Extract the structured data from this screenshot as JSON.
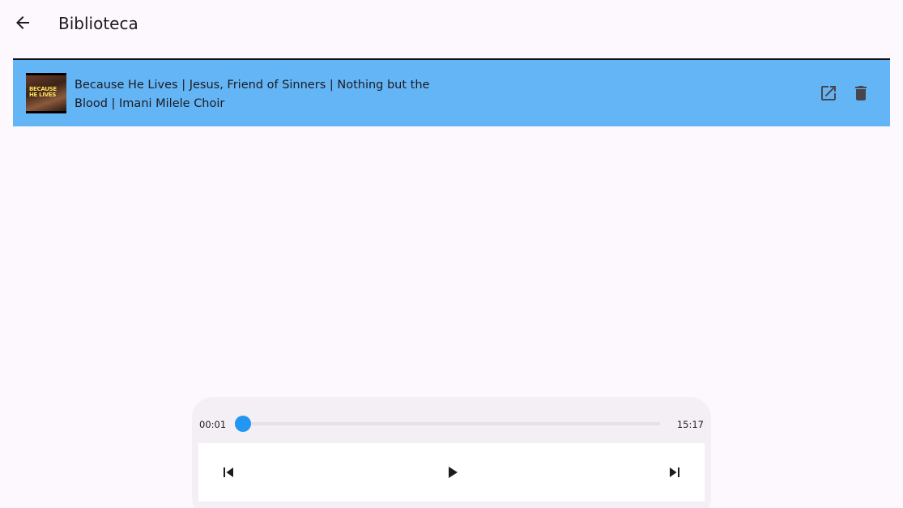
{
  "app_bar": {
    "back_icon": "arrow-back-icon",
    "title": "Biblioteca"
  },
  "library": {
    "items": [
      {
        "title": "Because He Lives | Jesus, Friend of Sinners | Nothing but the Blood | Imani Milele Choir",
        "thumbnail_text": "BECAUSE HE LIVES",
        "open_icon": "open-in-new-icon",
        "delete_icon": "delete-icon",
        "selected": true
      }
    ]
  },
  "player": {
    "elapsed": "00:01",
    "duration": "15:17",
    "progress": 0.001,
    "controls": {
      "previous_icon": "skip-previous-icon",
      "play_icon": "play-icon",
      "next_icon": "skip-next-icon"
    }
  },
  "colors": {
    "background": "#fdf7fe",
    "selected_row": "#64b5f6",
    "accent": "#2196f3",
    "player_surface": "#f4eff4",
    "icon": "#49454f"
  }
}
